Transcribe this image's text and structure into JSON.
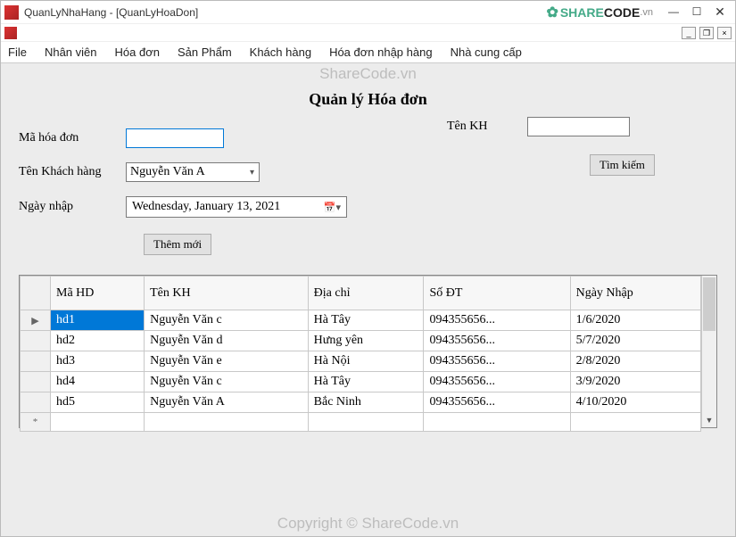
{
  "window": {
    "title": "QuanLyNhaHang - [QuanLyHoaDon]"
  },
  "logo": {
    "share": "SHARE",
    "code": "CODE",
    "vn": ".vn"
  },
  "menus": [
    "File",
    "Nhân viên",
    "Hóa đơn",
    "Sản Phẩm",
    "Khách hàng",
    "Hóa đơn nhập hàng",
    "Nhà cung cấp"
  ],
  "watermarks": {
    "top": "ShareCode.vn",
    "bottom": "Copyright © ShareCode.vn"
  },
  "page": {
    "title": "Quản lý Hóa đơn",
    "labels": {
      "mahd": "Mã hóa đơn",
      "tenkh_combo": "Tên Khách hàng",
      "ngaynhap": "Ngày nhập",
      "tenkh_search": "Tên KH"
    },
    "fields": {
      "mahd": "",
      "tenkh_combo": "Nguyễn Văn A",
      "ngaynhap": "Wednesday,   January   13, 2021",
      "tenkh_search": ""
    },
    "buttons": {
      "search": "Tìm kiếm",
      "add": "Thêm mới"
    }
  },
  "grid": {
    "columns": [
      "Mã HD",
      "Tên KH",
      "Địa chỉ",
      "Số ĐT",
      "Ngày Nhập"
    ],
    "rows": [
      {
        "mahd": "hd1",
        "tenkh": "Nguyễn Văn c",
        "diachi": "Hà Tây",
        "sodt": "094355656...",
        "ngay": "1/6/2020",
        "selected": true,
        "indicator": "▶"
      },
      {
        "mahd": "hd2",
        "tenkh": "Nguyễn Văn d",
        "diachi": "Hưng yên",
        "sodt": "094355656...",
        "ngay": "5/7/2020"
      },
      {
        "mahd": "hd3",
        "tenkh": "Nguyễn Văn e",
        "diachi": "Hà Nội",
        "sodt": "094355656...",
        "ngay": "2/8/2020"
      },
      {
        "mahd": "hd4",
        "tenkh": "Nguyễn Văn c",
        "diachi": "Hà Tây",
        "sodt": "094355656...",
        "ngay": "3/9/2020"
      },
      {
        "mahd": "hd5",
        "tenkh": "Nguyễn Văn A",
        "diachi": "Bắc Ninh",
        "sodt": "094355656...",
        "ngay": "4/10/2020"
      }
    ],
    "newrow_indicator": "*"
  }
}
